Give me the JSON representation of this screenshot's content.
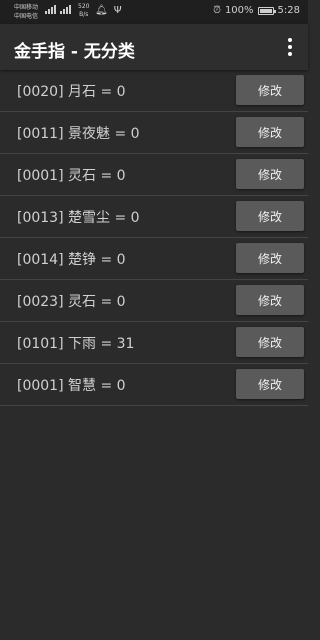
{
  "status_bar": {
    "carrier1": "中国移动",
    "carrier2": "中国电信",
    "net_speed_value": "520",
    "net_speed_unit": "B/s",
    "battery_percent": "100%",
    "time": "5:28"
  },
  "app_bar": {
    "title": "金手指 - 无分类"
  },
  "rows": [
    {
      "label": "[0020] 月石 = 0",
      "button": "修改"
    },
    {
      "label": "[0011] 景夜魅 = 0",
      "button": "修改"
    },
    {
      "label": "[0001] 灵石 = 0",
      "button": "修改"
    },
    {
      "label": "[0013] 楚雪尘 = 0",
      "button": "修改"
    },
    {
      "label": "[0014] 楚铮 = 0",
      "button": "修改"
    },
    {
      "label": "[0023] 灵石 = 0",
      "button": "修改"
    },
    {
      "label": "[0101] 下雨 = 31",
      "button": "修改"
    },
    {
      "label": "[0001] 智慧 = 0",
      "button": "修改"
    }
  ],
  "icons": {
    "overflow": "more-vert-icon",
    "alarm": "alarm-icon",
    "battery": "battery-icon",
    "signal": "signal-icon"
  },
  "colors": {
    "background": "#2b2b2b",
    "app_bar": "#2e2e2e",
    "button": "#5a5a5a"
  }
}
